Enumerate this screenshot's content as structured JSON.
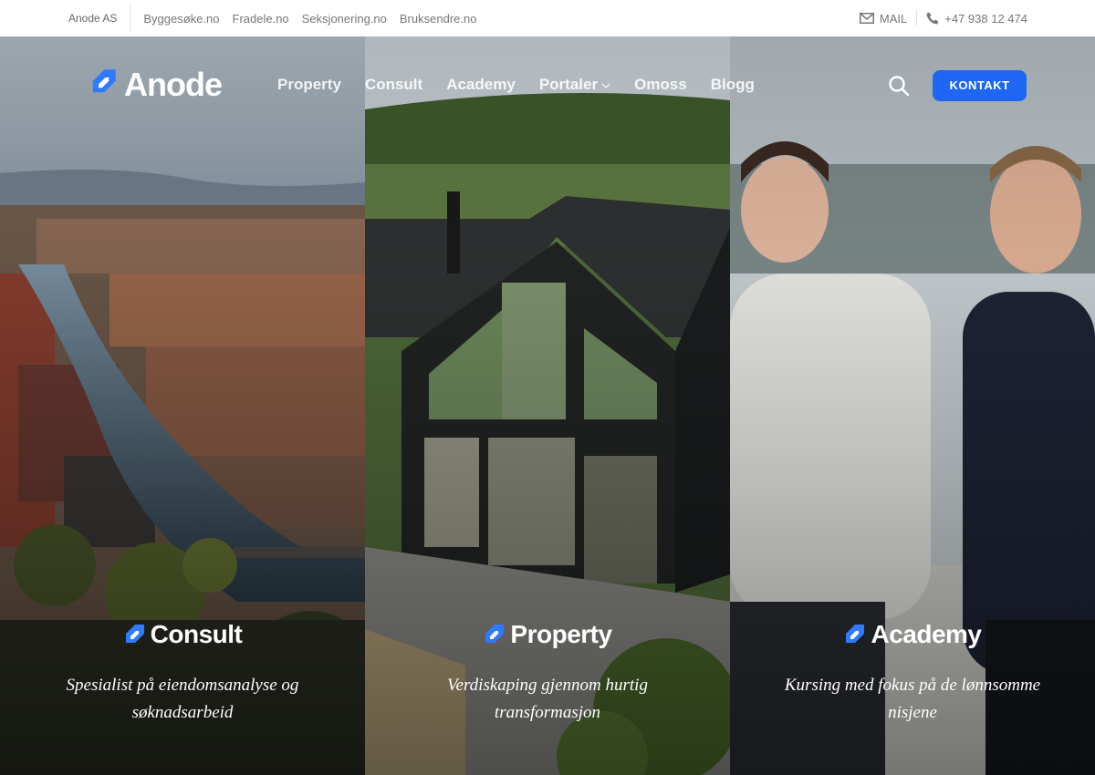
{
  "topbar": {
    "brand": "Anode AS",
    "links": [
      "Byggesøke.no",
      "Fradele.no",
      "Seksjonering.no",
      "Bruksendre.no"
    ],
    "mail_label": "MAIL",
    "phone": "+47 938 12 474"
  },
  "nav": {
    "logo_text": "Anode",
    "menu": [
      "Property",
      "Consult",
      "Academy",
      "Portaler",
      "Omoss",
      "Blogg"
    ],
    "cta_label": "KONTAKT"
  },
  "panels": [
    {
      "title": "Consult",
      "description": "Spesialist på eiendomsanalyse og søknadsarbeid"
    },
    {
      "title": "Property",
      "description": "Verdiskaping gjennom hurtig transformasjon"
    },
    {
      "title": "Academy",
      "description": "Kursing med fokus på de lønnsomme nisjene"
    }
  ],
  "colors": {
    "accent": "#1f66f5",
    "logo_mark": "#2f7bff"
  }
}
